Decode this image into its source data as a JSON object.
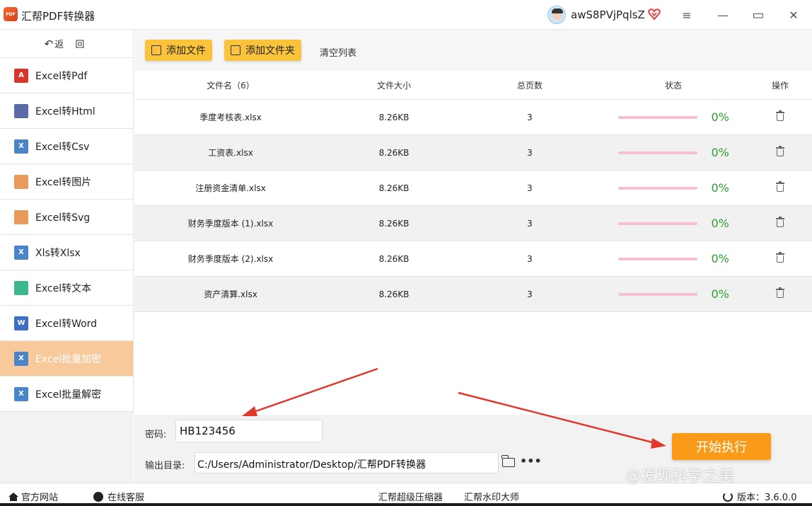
{
  "window": {
    "app_logo_text": "PDF",
    "app_title": "汇帮PDF转换器",
    "username": "awS8PVjPqlsZ",
    "controls": [
      "≡",
      "—",
      "▭",
      "✕"
    ]
  },
  "sidebar": {
    "back_label": "返 回",
    "back_icon": "↶",
    "items": [
      {
        "label": "Excel转Pdf",
        "icon": "pdf-icon",
        "icon_text": "A",
        "color": "#d9362b"
      },
      {
        "label": "Excel转Html",
        "icon": "html-icon",
        "icon_text": "",
        "color": "#5b6aa8"
      },
      {
        "label": "Excel转Csv",
        "icon": "csv-icon",
        "icon_text": "X",
        "color": "#4a84c9"
      },
      {
        "label": "Excel转图片",
        "icon": "image-icon",
        "icon_text": "",
        "color": "#e89a5c"
      },
      {
        "label": "Excel转Svg",
        "icon": "svg-icon",
        "icon_text": "",
        "color": "#e89a5c"
      },
      {
        "label": "Xls转Xlsx",
        "icon": "xlsx-icon",
        "icon_text": "X",
        "color": "#4a84c9"
      },
      {
        "label": "Excel转文本",
        "icon": "text-icon",
        "icon_text": "",
        "color": "#3bb88f"
      },
      {
        "label": "Excel转Word",
        "icon": "word-icon",
        "icon_text": "W",
        "color": "#3d6fc2"
      },
      {
        "label": "Excel批量加密",
        "icon": "encrypt-icon",
        "icon_text": "X",
        "color": "#4a84c9",
        "active": true
      },
      {
        "label": "Excel批量解密",
        "icon": "decrypt-icon",
        "icon_text": "X",
        "color": "#4a84c9"
      }
    ]
  },
  "toolbar": {
    "add_file": "添加文件",
    "add_folder": "添加文件夹",
    "clear_list": "清空列表"
  },
  "table": {
    "headers": {
      "name": "文件名（6）",
      "size": "文件大小",
      "pages": "总页数",
      "status": "状态",
      "op": "操作"
    },
    "rows": [
      {
        "name": "季度考核表.xlsx",
        "size": "8.26KB",
        "pages": "3",
        "progress": "0%"
      },
      {
        "name": "工资表.xlsx",
        "size": "8.26KB",
        "pages": "3",
        "progress": "0%"
      },
      {
        "name": "注册资金清单.xlsx",
        "size": "8.26KB",
        "pages": "3",
        "progress": "0%"
      },
      {
        "name": "财务季度版本 (1).xlsx",
        "size": "8.26KB",
        "pages": "3",
        "progress": "0%"
      },
      {
        "name": "财务季度版本 (2).xlsx",
        "size": "8.26KB",
        "pages": "3",
        "progress": "0%"
      },
      {
        "name": "资产清算.xlsx",
        "size": "8.26KB",
        "pages": "3",
        "progress": "0%"
      }
    ]
  },
  "settings": {
    "password_label": "密码:",
    "password_value": "HB123456",
    "output_label": "输出目录:",
    "output_value": "C:/Users/Administrator/Desktop/汇帮PDF转换器",
    "more": "•••",
    "start_button": "开始执行"
  },
  "statusbar": {
    "official_site": "官方网站",
    "online_support": "在线客服",
    "compressor": "汇帮超级压缩器",
    "watermark_tool": "汇帮水印大师",
    "version": "版本：3.6.0.0"
  },
  "watermark_text": "@发现科学之美",
  "colors": {
    "accent_yellow": "#f9c33b",
    "start_orange": "#f99a18",
    "active_sidebar": "#f8c99a",
    "progress_green": "#2ea02e",
    "annotation_red": "#e0392b"
  }
}
